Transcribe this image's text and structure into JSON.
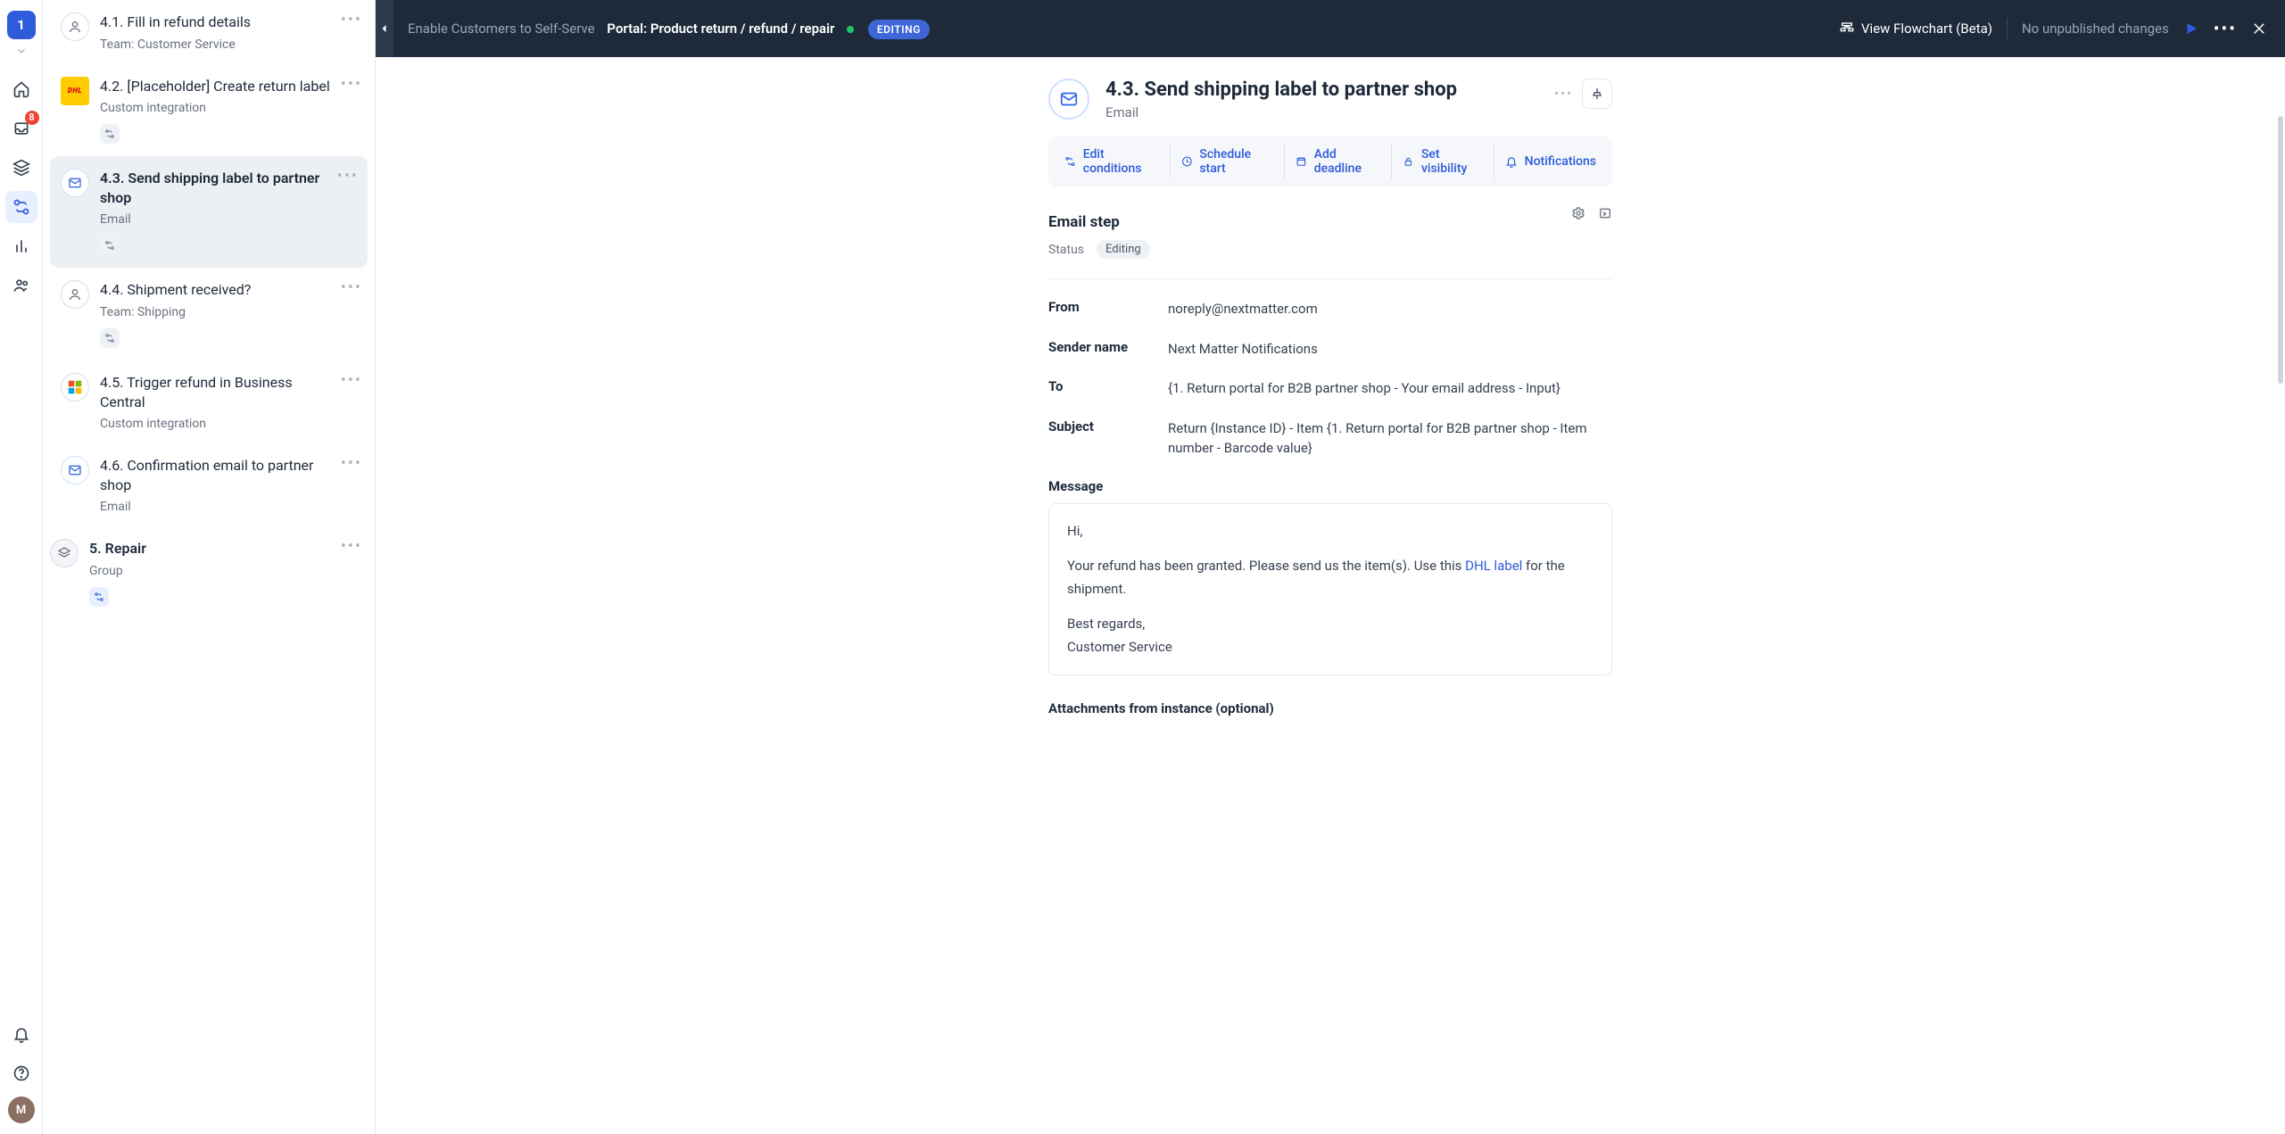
{
  "rail": {
    "logo": "1",
    "inbox_badge": "8",
    "avatar_initial": "M"
  },
  "topbar": {
    "breadcrumb_root": "Enable Customers to Self-Serve",
    "breadcrumb_current": "Portal: Product return / refund / repair",
    "editing_pill": "EDITING",
    "view_flowchart": "View Flowchart (Beta)",
    "publish_status": "No unpublished changes"
  },
  "steps": {
    "s1": {
      "title": "4.1. Fill in refund details",
      "sub": "Team: Customer Service"
    },
    "s2": {
      "title": "4.2. [Placeholder] Create return label",
      "sub": "Custom integration",
      "dhl": "DHL"
    },
    "s3": {
      "title": "4.3. Send shipping label to partner shop",
      "sub": "Email"
    },
    "s4": {
      "title": "4.4. Shipment received?",
      "sub": "Team: Shipping"
    },
    "s5": {
      "title": "4.5. Trigger refund in Business Central",
      "sub": "Custom integration"
    },
    "s6": {
      "title": "4.6. Confirmation email to partner shop",
      "sub": "Email"
    },
    "g5": {
      "title": "5. Repair",
      "sub": "Group"
    }
  },
  "detail": {
    "number": "4.3.",
    "title": "Send shipping label to partner shop",
    "type": "Email",
    "actions": {
      "edit_conditions": "Edit conditions",
      "schedule_start": "Schedule start",
      "add_deadline": "Add deadline",
      "set_visibility": "Set visibility",
      "notifications": "Notifications"
    },
    "section_title": "Email step",
    "status_label": "Status",
    "status_value": "Editing",
    "fields": {
      "from_label": "From",
      "from_value": "noreply@nextmatter.com",
      "sender_label": "Sender name",
      "sender_value": "Next Matter Notifications",
      "to_label": "To",
      "to_value": "{1. Return portal for B2B partner shop - Your email address - Input}",
      "subject_label": "Subject",
      "subject_value": "Return {Instance ID} - Item {1. Return portal for B2B partner shop - Item number - Barcode value}",
      "message_label": "Message",
      "attachments_label": "Attachments from instance (optional)"
    },
    "message": {
      "greeting": "Hi,",
      "body_pre": "Your refund has been granted. Please send us the item(s). Use this ",
      "link_text": "DHL label",
      "body_post": " for the shipment.",
      "signoff1": "Best regards,",
      "signoff2": "Customer Service"
    }
  }
}
